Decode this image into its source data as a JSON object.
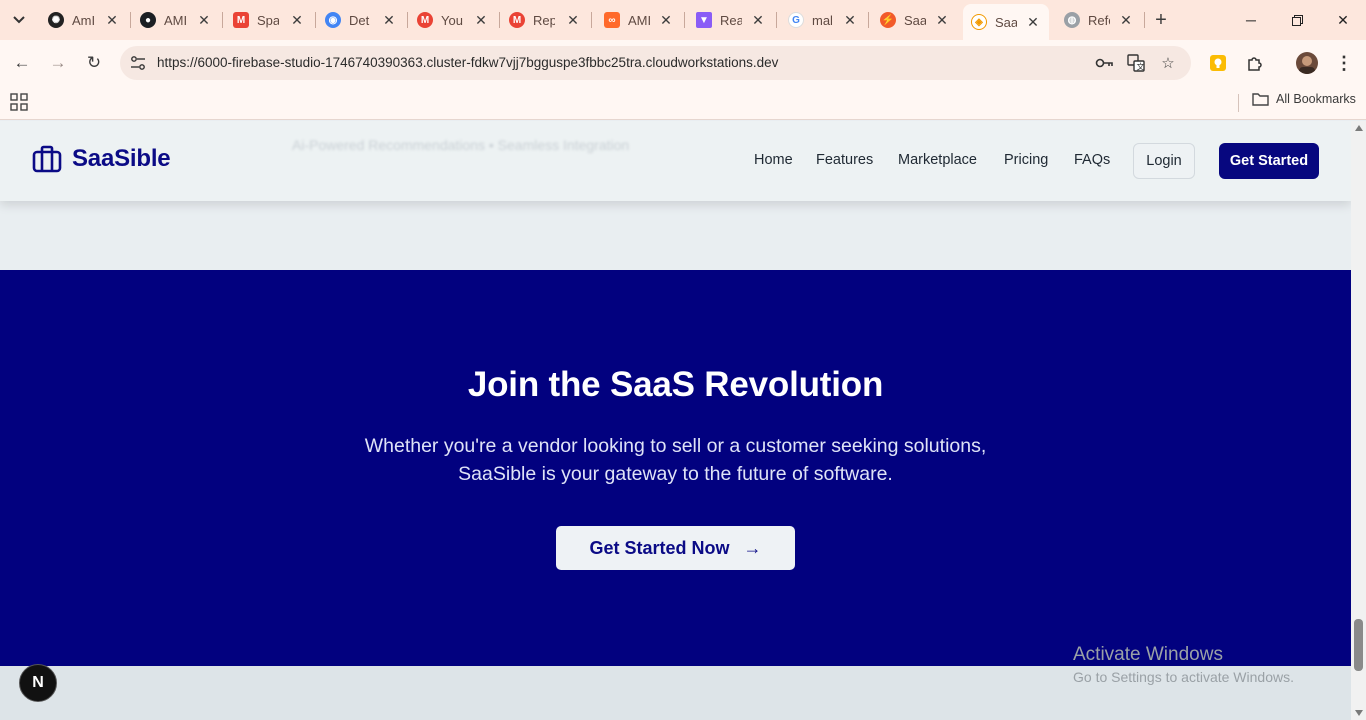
{
  "browser": {
    "tabs": [
      {
        "label": "AmI",
        "icon": "openai-icon"
      },
      {
        "label": "AMI",
        "icon": "github-icon"
      },
      {
        "label": "Spa",
        "icon": "gmail-icon"
      },
      {
        "label": "Det",
        "icon": "chrome-icon"
      },
      {
        "label": "You",
        "icon": "gmail-icon"
      },
      {
        "label": "Rep",
        "icon": "gmail-icon"
      },
      {
        "label": "AMI",
        "icon": "make-icon"
      },
      {
        "label": "Rea",
        "icon": "vite-icon"
      },
      {
        "label": "mal",
        "icon": "google-icon"
      },
      {
        "label": "Saa",
        "icon": "bolt-icon"
      },
      {
        "label": "Saa",
        "icon": "firebase-icon",
        "active": true
      },
      {
        "label": "Refe",
        "icon": "globe-icon"
      }
    ],
    "url": "https://6000-firebase-studio-1746740390363.cluster-fdkw7vjj7bgguspe3fbbc25tra.cloudworkstations.dev",
    "bookmarks_label": "All Bookmarks"
  },
  "site": {
    "brand": "SaaSible",
    "ghost_text": "Ai-Powered Recommendations • Seamless Integration",
    "nav": [
      "Home",
      "Features",
      "Marketplace",
      "Pricing",
      "FAQs"
    ],
    "login": "Login",
    "get_started": "Get Started"
  },
  "cta": {
    "title": "Join the SaaS Revolution",
    "subtitle_line1": "Whether you're a vendor looking to sell or a customer seeking solutions,",
    "subtitle_line2": "SaaSible is your gateway to the future of software.",
    "button": "Get Started Now"
  },
  "badge": "N",
  "watermark": {
    "title": "Activate Windows",
    "subtitle": "Go to Settings to activate Windows."
  },
  "colors": {
    "brand": "#0b0b86",
    "cta_bg": "#02017f",
    "tabbar": "#fde7dd"
  }
}
